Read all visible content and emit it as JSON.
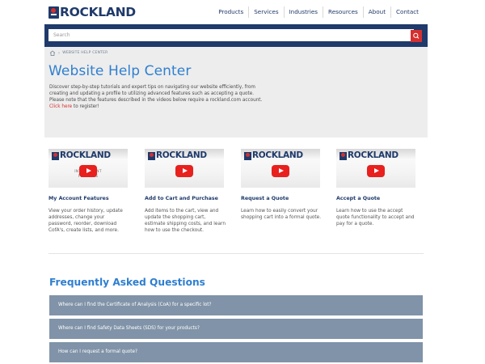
{
  "brand": {
    "name": "ROCKLAND"
  },
  "nav": [
    "Products",
    "Services",
    "Industries",
    "Resources",
    "About",
    "Contact"
  ],
  "search": {
    "placeholder": "Search",
    "button_icon": "search-icon"
  },
  "breadcrumb": {
    "home_icon": "home-icon",
    "current": "WEBSITE HELP CENTER"
  },
  "page": {
    "title": "Website Help Center",
    "intro": "Discover step-by-step tutorials and expert tips on navigating our website efficiently, from creating and updating a profile to utilizing advanced features such as accepting a quote. Please note that the features described in the videos below require a rockland.com account.",
    "intro_link": "Click here",
    "intro_suffix": " to register!"
  },
  "videos": [
    {
      "thumb_brand": "ROCKLAND",
      "thumb_caption": "INTRO        COUNT\nFEATURES",
      "title": "My Account Features",
      "desc": "View your order history, update addresses, change your password, reorder, download CofA's, create lists, and more."
    },
    {
      "thumb_brand": "ROCKLAND",
      "thumb_caption": "AD          RT",
      "title": "Add to Cart and Purchase",
      "desc": "Add items to the cart, view and update the shopping cart, estimate shipping costs, and learn how to use the checkout."
    },
    {
      "thumb_brand": "ROCKLAND",
      "thumb_caption": "CA          TE",
      "title": "Request a Quote",
      "desc": "Learn how to easily convert your shopping cart into a formal quote."
    },
    {
      "thumb_brand": "ROCKLAND",
      "thumb_caption": "ACC          TE",
      "title": "Accept a Quote",
      "desc": "Learn how to use the accept quote functionality to accept and pay for a quote."
    }
  ],
  "faq": {
    "title": "Frequently Asked Questions",
    "items": [
      "Where can I find the Certificate of Analysis (CoA) for a specific lot?",
      "Where can I find Safety Data Sheets (SDS) for your products?",
      "How can I request a formal quote?"
    ]
  },
  "colors": {
    "brand_navy": "#1f3a6b",
    "accent_red": "#d5302f",
    "title_blue": "#2f7fd0",
    "faq_bg": "#8093a8"
  }
}
